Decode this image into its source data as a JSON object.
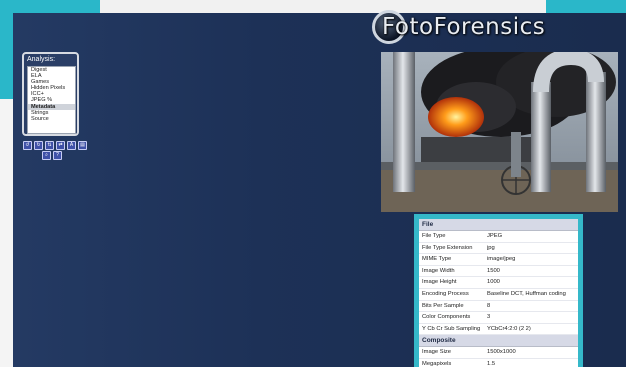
{
  "app": {
    "logo_text": "FotoForensics"
  },
  "analysis": {
    "title": "Analysis:",
    "items": [
      {
        "label": "Digest"
      },
      {
        "label": "ELA"
      },
      {
        "label": "Games"
      },
      {
        "label": "Hidden Pixels"
      },
      {
        "label": "ICC+"
      },
      {
        "label": "JPEG %"
      },
      {
        "label": "Metadata"
      },
      {
        "label": "Strings"
      },
      {
        "label": "Source"
      }
    ],
    "selected": "Metadata"
  },
  "toolbar": {
    "row1": [
      {
        "glyph": "↺",
        "name": "rotate-left-icon"
      },
      {
        "glyph": "↻",
        "name": "rotate-right-icon"
      },
      {
        "glyph": "⇅",
        "name": "flip-icon"
      },
      {
        "glyph": "⇄",
        "name": "mirror-icon"
      },
      {
        "glyph": "A",
        "name": "text-icon"
      },
      {
        "glyph": "▤",
        "name": "info-icon"
      }
    ],
    "row2": [
      {
        "glyph": "⌕",
        "name": "zoom-icon"
      },
      {
        "glyph": "?",
        "name": "help-icon"
      }
    ]
  },
  "metadata": {
    "file_section_title": "File",
    "file_rows": [
      {
        "key": "File Type",
        "value": "JPEG"
      },
      {
        "key": "File Type Extension",
        "value": "jpg"
      },
      {
        "key": "MIME Type",
        "value": "image/jpeg"
      },
      {
        "key": "Image Width",
        "value": "1500"
      },
      {
        "key": "Image Height",
        "value": "1000"
      },
      {
        "key": "Encoding Process",
        "value": "Baseline DCT, Huffman coding"
      },
      {
        "key": "Bits Per Sample",
        "value": "8"
      },
      {
        "key": "Color Components",
        "value": "3"
      },
      {
        "key": "Y Cb Cr Sub Sampling",
        "value": "YCbCr4:2:0 (2 2)"
      }
    ],
    "composite_section_title": "Composite",
    "composite_rows": [
      {
        "key": "Image Size",
        "value": "1500x1000"
      },
      {
        "key": "Megapixels",
        "value": "1.5"
      }
    ]
  },
  "colors": {
    "accent_cyan": "#2ab7c9",
    "frame_navy": "#1d3157"
  }
}
